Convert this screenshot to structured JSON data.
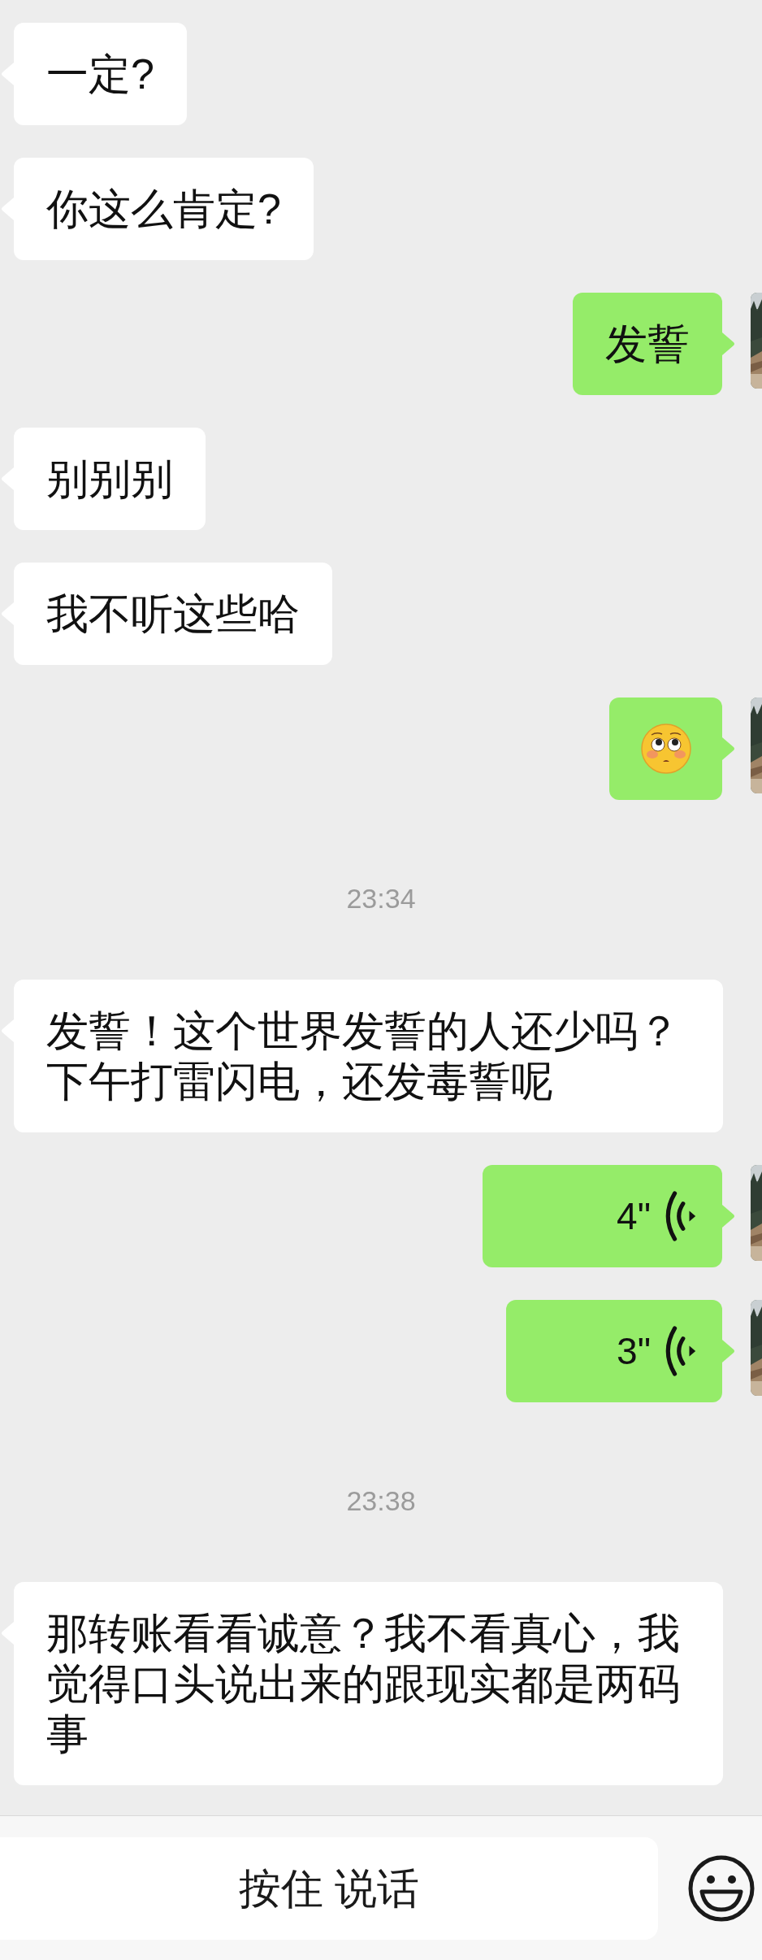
{
  "messages": [
    {
      "kind": "text",
      "sent": false,
      "text": "一定?"
    },
    {
      "kind": "text",
      "sent": false,
      "text": "你这么肯定?"
    },
    {
      "kind": "text",
      "sent": true,
      "text": "发誓"
    },
    {
      "kind": "text",
      "sent": false,
      "text": "别别别"
    },
    {
      "kind": "text",
      "sent": false,
      "text": "我不听这些哈"
    },
    {
      "kind": "emoji",
      "sent": true
    },
    {
      "kind": "time",
      "text": "23:34"
    },
    {
      "kind": "text",
      "sent": false,
      "text": "发誓！这个世界发誓的人还少吗？下午打雷闪电，还发毒誓呢"
    },
    {
      "kind": "voice",
      "sent": true,
      "duration": "4\""
    },
    {
      "kind": "voice",
      "sent": true,
      "duration": "3\""
    },
    {
      "kind": "time",
      "text": "23:38"
    },
    {
      "kind": "text",
      "sent": false,
      "text": "那转账看看诚意？我不看真心，我觉得口头说出来的跟现实都是两码事"
    }
  ],
  "input_bar": {
    "hold_to_talk": "按住 说话"
  }
}
